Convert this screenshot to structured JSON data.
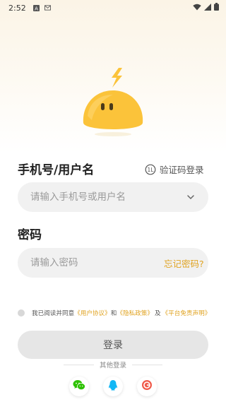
{
  "status_bar": {
    "time": "2:52",
    "icons": [
      "notification-a-icon",
      "notification-mail-icon",
      "wifi-icon",
      "signal-icon",
      "battery-icon"
    ]
  },
  "login": {
    "title": "手机号/用户名",
    "sms_login_label": "验证码登录",
    "username_placeholder": "请输入手机号或用户名",
    "password_title": "密码",
    "password_placeholder": "请输入密码",
    "forgot_password": "忘记密码?",
    "agreement": {
      "prefix": "我已阅读并同意",
      "user_agreement": "《用户协议》",
      "and": "和",
      "privacy_policy": "《隐私政策》",
      "conjunction": "及",
      "disclaimer": "《平台免责声明》"
    },
    "submit_label": "登录",
    "other_login_label": "其他登录",
    "social_logins": [
      "wechat-icon",
      "qq-icon",
      "other-login-icon"
    ]
  },
  "colors": {
    "accent": "#e0a321",
    "mascot": "#fbc33a",
    "field_bg": "#f1f1f1",
    "button_bg": "#e6e6e6"
  }
}
